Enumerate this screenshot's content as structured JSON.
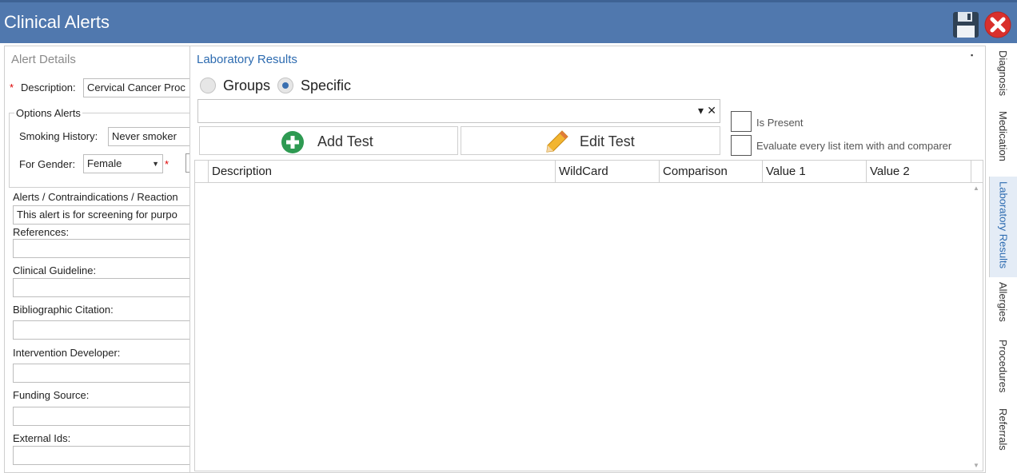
{
  "window": {
    "title": "Clinical Alerts"
  },
  "alert_details": {
    "header": "Alert Details",
    "required_mark": "*",
    "description_label": "Description:",
    "description_value": "Cervical Cancer Proc",
    "options_header": "Options Alerts",
    "smoking_label": "Smoking History:",
    "smoking_value": "Never smoker",
    "gender_label": "For Gender:",
    "gender_value": "Female",
    "alerts_label": "Alerts / Contraindications / Reaction",
    "alerts_value": "This alert is for screening for purpo",
    "references_label": "References:",
    "guideline_label": "Clinical Guideline:",
    "citation_label": "Bibliographic Citation:",
    "developer_label": "Intervention Developer:",
    "funding_label": "Funding Source:",
    "external_label": "External Ids:"
  },
  "lab": {
    "title": "Laboratory Results",
    "pin_glyph": "▪",
    "radio_groups": "Groups",
    "radio_specific": "Specific",
    "selected_radio": "Specific",
    "combo_dropdown_glyph": "▾",
    "combo_clear_glyph": "✕",
    "add_test": "Add Test",
    "edit_test": "Edit Test",
    "is_present": "Is Present",
    "evaluate_every": "Evaluate every list item with and comparer",
    "columns": [
      "Description",
      "WildCard",
      "Comparison",
      "Value 1",
      "Value 2"
    ],
    "scroll_up_glyph": "▲",
    "scroll_down_glyph": "▼"
  },
  "tabs": [
    "Diagnosis",
    "Medication",
    "Laboratory Results",
    "Allergies",
    "Procedures",
    "Referrals"
  ],
  "active_tab": "Laboratory Results",
  "colors": {
    "titlebar": "#5078ae",
    "accent": "#2d6bb0",
    "add_green": "#2e9a52",
    "close_red": "#d9302c"
  }
}
